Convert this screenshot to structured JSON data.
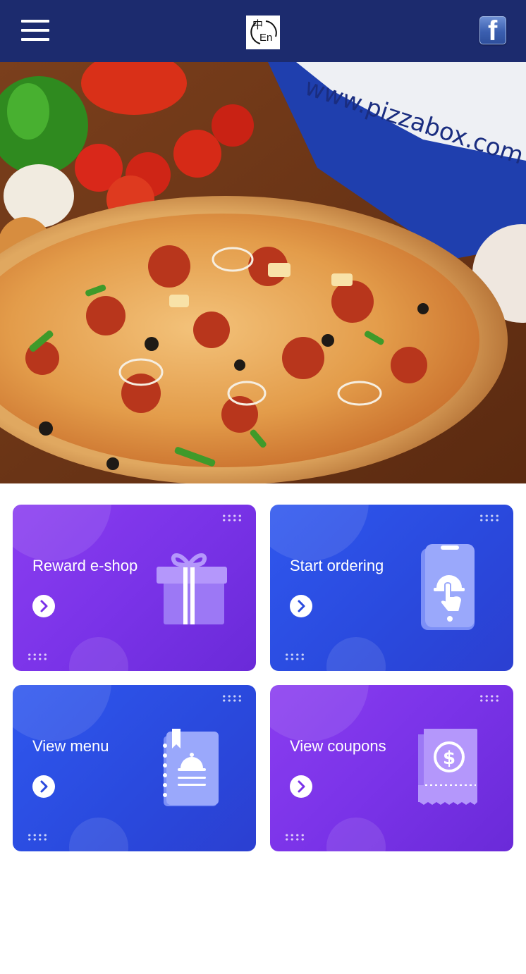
{
  "header": {
    "menu_icon": "hamburger-menu-icon",
    "language_toggle": {
      "zh": "中",
      "en": "En"
    },
    "social_icon": "facebook-icon",
    "social_letter": "f"
  },
  "hero": {
    "image": "pizza-banner",
    "box_text": "www.pizzabox.com"
  },
  "tiles": [
    {
      "title": "Reward e-shop",
      "icon": "gift-icon",
      "theme": "purple"
    },
    {
      "title": "Start ordering",
      "icon": "phone-order-icon",
      "theme": "blue"
    },
    {
      "title": "View menu",
      "icon": "menu-book-icon",
      "theme": "blue"
    },
    {
      "title": "View coupons",
      "icon": "coupon-icon",
      "theme": "purple"
    }
  ],
  "colors": {
    "header_bg": "#1c2b6e",
    "purple": "#7a33e8",
    "blue": "#2a4ade"
  }
}
